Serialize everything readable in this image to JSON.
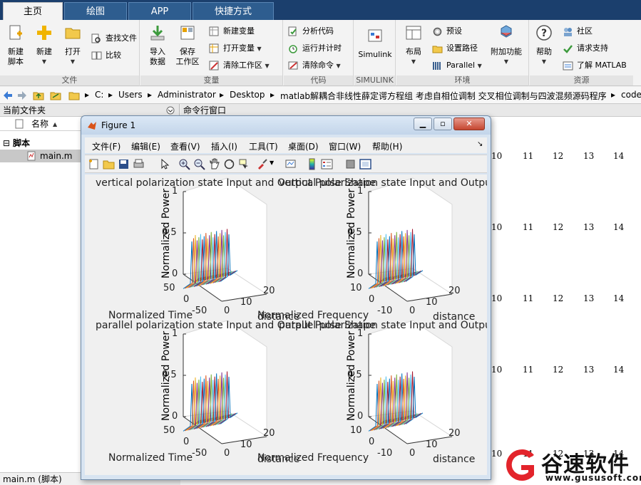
{
  "tabs": [
    {
      "label": "主页",
      "active": true
    },
    {
      "label": "绘图",
      "active": false
    },
    {
      "label": "APP",
      "active": false
    },
    {
      "label": "快捷方式",
      "active": false
    }
  ],
  "ribbon": {
    "file": {
      "label": "文件",
      "new_script": "新建\n脚本",
      "new": "新建",
      "open": "打开",
      "find_files": "查找文件",
      "compare": "比较"
    },
    "variable": {
      "label": "变量",
      "import": "导入\n数据",
      "save_ws": "保存\n工作区",
      "new_var": "新建变量",
      "open_var": "打开变量",
      "clear_ws": "清除工作区"
    },
    "code": {
      "label": "代码",
      "analyze": "分析代码",
      "run_time": "运行并计时",
      "clear_cmd": "清除命令"
    },
    "simulink": {
      "label": "SIMULINK",
      "btn": "Simulink"
    },
    "env": {
      "label": "环境",
      "layout": "布局",
      "prefs": "预设",
      "set_path": "设置路径",
      "parallel": "Parallel",
      "addons": "附加功能"
    },
    "resources": {
      "label": "资源",
      "help": "帮助",
      "community": "社区",
      "support": "请求支持",
      "learn": "了解 MATLAB"
    }
  },
  "address": {
    "path": [
      "C:",
      "Users",
      "Administrator",
      "Desktop",
      "matlab解耦合非线性薛定谔方程组 考虑自相位调制 交叉相位调制与四波混频源码程序",
      "code"
    ]
  },
  "left_panel": {
    "title": "当前文件夹",
    "col_name": "名称",
    "group": "脚本",
    "file": "main.m",
    "status": "main.m  (脚本)"
  },
  "command_window": {
    "title": "命令行窗口",
    "numbers": [
      "10",
      "11",
      "12",
      "13",
      "14"
    ]
  },
  "figure": {
    "title": "Figure 1",
    "menus": [
      "文件(F)",
      "编辑(E)",
      "查看(V)",
      "插入(I)",
      "工具(T)",
      "桌面(D)",
      "窗口(W)",
      "帮助(H)"
    ],
    "plots": [
      {
        "title": "vertical polarization state Input and Output Pulse Shape",
        "ylabel": "Normalized Power",
        "xlabel1": "Normalized Time",
        "xlabel2": "distance",
        "ticks_z": [
          "1",
          "0.5",
          "0"
        ],
        "ticks_x": [
          "50",
          "0",
          "-50"
        ],
        "ticks_y": [
          "0",
          "10",
          "20"
        ]
      },
      {
        "title": "vertical polarization state Input and Output Spectrum",
        "ylabel": "Normalized Power",
        "xlabel1": "Normalized Frequency",
        "xlabel2": "distance",
        "ticks_z": [
          "1",
          "0.5",
          "0"
        ],
        "ticks_x": [
          "10",
          "0",
          "-10"
        ],
        "ticks_y": [
          "0",
          "10",
          "20"
        ]
      },
      {
        "title": "parallel polarization state Input and Output Pulse Shape",
        "ylabel": "Normalized Power",
        "xlabel1": "Normalized Time",
        "xlabel2": "distance",
        "ticks_z": [
          "1",
          "0.5",
          "0"
        ],
        "ticks_x": [
          "50",
          "0",
          "-50"
        ],
        "ticks_y": [
          "0",
          "10",
          "20"
        ]
      },
      {
        "title": "parallel polarization state Input and Output Spectrum",
        "ylabel": "Normalized Power",
        "xlabel1": "Normalized Frequency",
        "xlabel2": "distance",
        "ticks_z": [
          "1",
          "0.5",
          "0"
        ],
        "ticks_x": [
          "10",
          "0",
          "-10"
        ],
        "ticks_y": [
          "0",
          "10",
          "20"
        ]
      }
    ],
    "line_colors": [
      "#0072bd",
      "#d95319",
      "#edb120",
      "#7e2f8e",
      "#77ac30",
      "#4dbeee",
      "#a2142f"
    ]
  },
  "watermark": {
    "name": "谷速软件",
    "url": "www.gususoft.com"
  }
}
